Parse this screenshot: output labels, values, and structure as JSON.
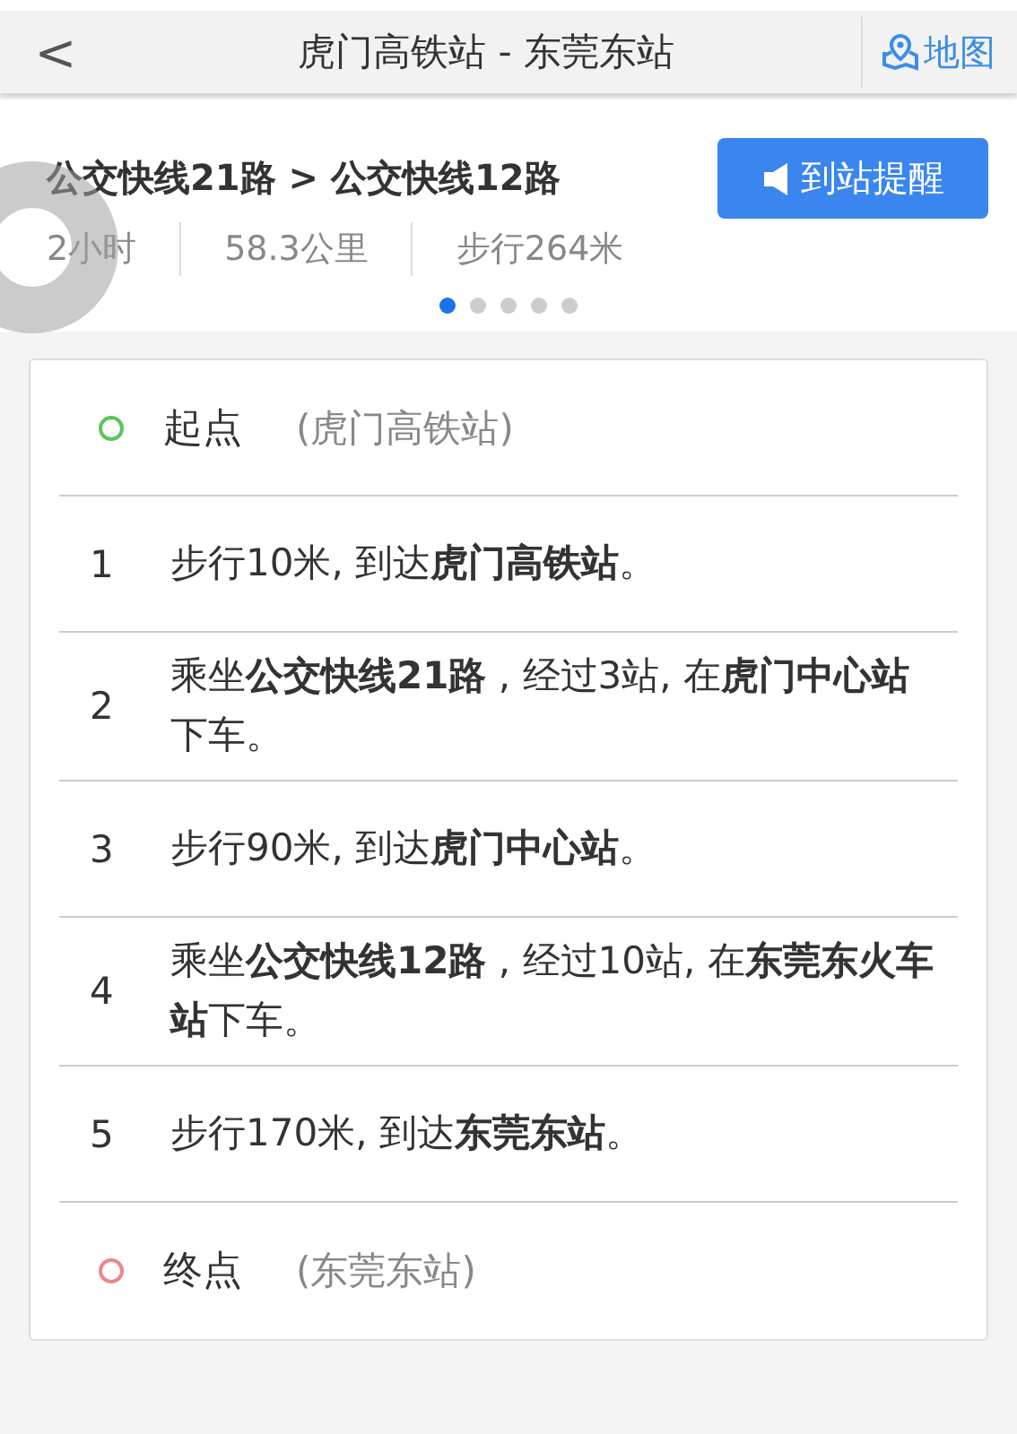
{
  "header": {
    "back": "<",
    "title": "虎门高铁站 - 东莞东站",
    "map_link": "地图"
  },
  "summary": {
    "route": "公交快线21路 > 公交快线12路",
    "remind_button": "到站提醒",
    "stats": [
      "2小时",
      "58.3公里",
      "步行264米"
    ],
    "pager": [
      {
        "selected": true
      },
      {
        "selected": false
      },
      {
        "selected": false
      },
      {
        "selected": false
      },
      {
        "selected": false
      }
    ]
  },
  "steps": [
    {
      "kind": "endpoint",
      "color": "#5cc55c",
      "label": "起点",
      "station": "(虎门高铁站)"
    },
    {
      "kind": "step",
      "number": "1",
      "text": "步行10米, 到达**虎门高铁站**。"
    },
    {
      "kind": "step",
      "number": "2",
      "text": "乘坐**公交快线21路** , 经过3站, 在**虎门中心站**下车。"
    },
    {
      "kind": "step",
      "number": "3",
      "text": "步行90米, 到达**虎门中心站**。"
    },
    {
      "kind": "step",
      "number": "4",
      "text": "乘坐**公交快线12路** , 经过10站, 在**东莞东火车站**下车。"
    },
    {
      "kind": "step",
      "number": "5",
      "text": "步行170米, 到达**东莞东站**。"
    },
    {
      "kind": "endpoint",
      "color": "#e88a8a",
      "label": "终点",
      "station": "(东莞东站)"
    }
  ]
}
